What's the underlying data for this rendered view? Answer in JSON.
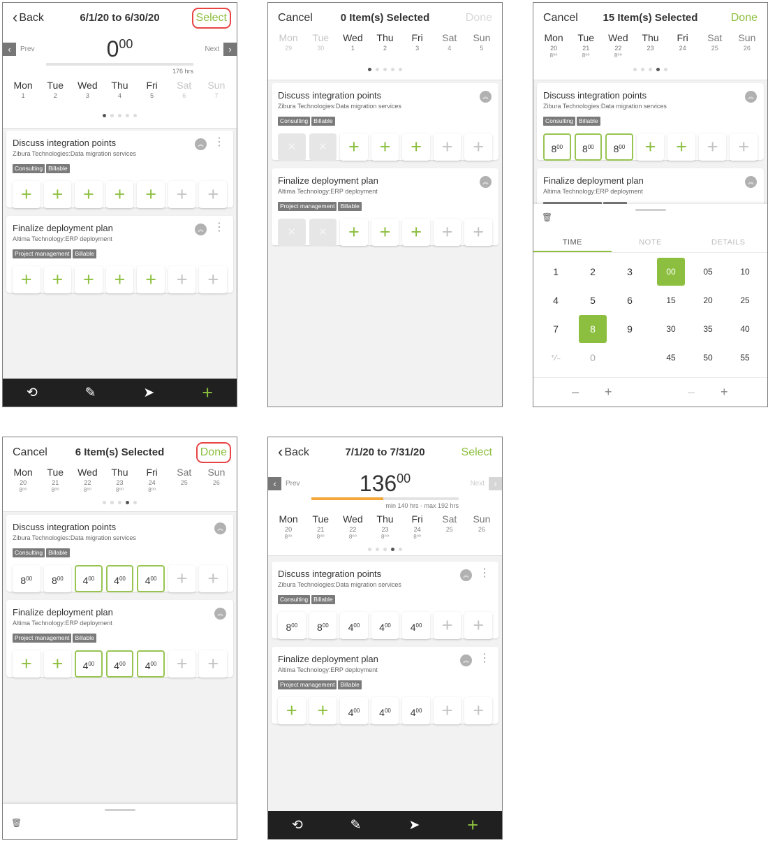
{
  "icons": {
    "back": "‹",
    "prev": "‹",
    "next": "›",
    "history": "⟲",
    "edit": "✎",
    "send": "➤",
    "add": "+",
    "trash": "🗑",
    "kebab": "⋮",
    "collapse": "︽",
    "plus_cell": "+",
    "x_cell": "✕",
    "minus": "–",
    "plus": "+"
  },
  "screen1": {
    "back_label": "Back",
    "title": "6/1/20 to 6/30/20",
    "select_label": "Select",
    "prev_label": "Prev",
    "next_label": "Next",
    "total_hours": "0",
    "total_minutes": "00",
    "target_label": "176 hrs",
    "days": [
      {
        "name": "Mon",
        "date": "1"
      },
      {
        "name": "Tue",
        "date": "2"
      },
      {
        "name": "Wed",
        "date": "3"
      },
      {
        "name": "Thu",
        "date": "4"
      },
      {
        "name": "Fri",
        "date": "5"
      },
      {
        "name": "Sat",
        "date": "6"
      },
      {
        "name": "Sun",
        "date": "7"
      }
    ],
    "page_dots": 5,
    "active_dot": 1
  },
  "screen2": {
    "cancel_label": "Cancel",
    "title": "0 Item(s) Selected",
    "done_label": "Done",
    "days": [
      {
        "name": "Mon",
        "date": "29"
      },
      {
        "name": "Tue",
        "date": "30"
      },
      {
        "name": "Wed",
        "date": "1"
      },
      {
        "name": "Thu",
        "date": "2"
      },
      {
        "name": "Fri",
        "date": "3"
      },
      {
        "name": "Sat",
        "date": "4"
      },
      {
        "name": "Sun",
        "date": "5"
      }
    ],
    "active_dot": 1
  },
  "screen3": {
    "cancel_label": "Cancel",
    "title": "15 Item(s) Selected",
    "done_label": "Done",
    "days": [
      {
        "name": "Mon",
        "date": "20",
        "hours": "8⁰⁰"
      },
      {
        "name": "Tue",
        "date": "21",
        "hours": "8⁰⁰"
      },
      {
        "name": "Wed",
        "date": "22",
        "hours": "8⁰⁰"
      },
      {
        "name": "Thu",
        "date": "23",
        "hours": ""
      },
      {
        "name": "Fri",
        "date": "24",
        "hours": ""
      },
      {
        "name": "Sat",
        "date": "25",
        "hours": ""
      },
      {
        "name": "Sun",
        "date": "26",
        "hours": ""
      }
    ],
    "active_dot": 4,
    "sheet_tabs": [
      "TIME",
      "NOTE",
      "DETAILS"
    ],
    "hour_keys": [
      "1",
      "2",
      "3",
      "4",
      "5",
      "6",
      "7",
      "8",
      "9",
      "⁺∕₋",
      "0"
    ],
    "minute_keys": [
      "00",
      "05",
      "10",
      "15",
      "20",
      "25",
      "30",
      "35",
      "40",
      "45",
      "50",
      "55"
    ],
    "selected_hour": "8",
    "selected_minute": "00"
  },
  "screen4": {
    "cancel_label": "Cancel",
    "title": "6 Item(s) Selected",
    "done_label": "Done",
    "days": [
      {
        "name": "Mon",
        "date": "20",
        "hours": "8⁰⁰"
      },
      {
        "name": "Tue",
        "date": "21",
        "hours": "8⁰⁰"
      },
      {
        "name": "Wed",
        "date": "22",
        "hours": "8⁰⁰"
      },
      {
        "name": "Thu",
        "date": "23",
        "hours": "8⁰⁰"
      },
      {
        "name": "Fri",
        "date": "24",
        "hours": "8⁰⁰"
      },
      {
        "name": "Sat",
        "date": "25",
        "hours": ""
      },
      {
        "name": "Sun",
        "date": "26",
        "hours": ""
      }
    ],
    "active_dot": 4
  },
  "screen5": {
    "back_label": "Back",
    "title": "7/1/20 to 7/31/20",
    "select_label": "Select",
    "prev_label": "Prev",
    "next_label": "Next",
    "total_hours": "136",
    "total_minutes": "00",
    "range_label": "min 140 hrs - max 192 hrs",
    "progress": 0.49,
    "days": [
      {
        "name": "Mon",
        "date": "20",
        "hours": "8⁰⁰"
      },
      {
        "name": "Tue",
        "date": "21",
        "hours": "8⁰⁰"
      },
      {
        "name": "Wed",
        "date": "22",
        "hours": "8⁰⁰"
      },
      {
        "name": "Thu",
        "date": "23",
        "hours": "8⁰⁰"
      },
      {
        "name": "Fri",
        "date": "24",
        "hours": "8⁰⁰"
      },
      {
        "name": "Sat",
        "date": "25",
        "hours": ""
      },
      {
        "name": "Sun",
        "date": "26",
        "hours": ""
      }
    ],
    "active_dot": 4
  },
  "tasks": [
    {
      "title": "Discuss integration points",
      "subtitle": "Zibura Technologies:Data migration services",
      "tags": [
        "Consulting",
        "Billable"
      ]
    },
    {
      "title": "Finalize deployment plan",
      "subtitle": "Altima Technology:ERP deployment",
      "tags": [
        "Project management",
        "Billable"
      ]
    }
  ],
  "cell_values": {
    "s3_task1": [
      "8",
      "8",
      "8",
      "+",
      "+",
      "+",
      "+"
    ],
    "s4_task1": [
      "8",
      "8",
      "4",
      "4",
      "4",
      "+",
      "+"
    ],
    "s4_task2": [
      "+",
      "+",
      "4",
      "4",
      "4",
      "+",
      "+"
    ],
    "s5_task1": [
      "8",
      "8",
      "4",
      "4",
      "4",
      "+",
      "+"
    ],
    "s5_task2": [
      "+",
      "+",
      "4",
      "4",
      "4",
      "+",
      "+"
    ],
    "minutes": "00"
  },
  "colors": {
    "accent_green": "#8cbf3f",
    "highlight_red": "#e84545",
    "progress_orange": "#f3a73b",
    "nav_dark": "#202020"
  }
}
